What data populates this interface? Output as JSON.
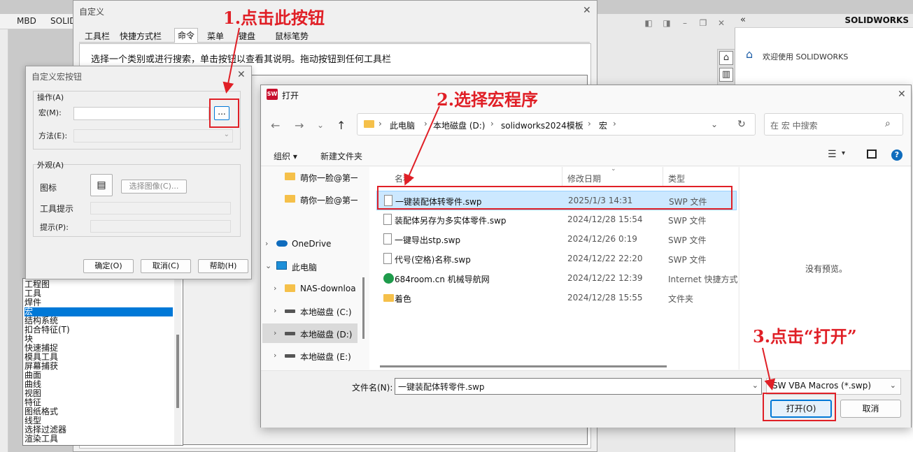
{
  "background": {
    "top_tabs": [
      "MBD",
      "SOLID"
    ],
    "task_pane": {
      "brand": "SOLIDWORKS",
      "welcome": "欢迎使用 SOLIDWORKS"
    }
  },
  "customize_dialog": {
    "title": "自定义",
    "tabs": [
      "工具栏",
      "快捷方式栏",
      "命令",
      "菜单",
      "键盘",
      "鼠标笔势"
    ],
    "active_tab": "命令",
    "description": "选择一个类别或进行搜索，单击按钮以查看其说明。拖动按钮到任何工具栏",
    "categories": [
      "工程图",
      "工具",
      "焊件",
      "宏",
      "结构系统",
      "扣合特征(T)",
      "块",
      "快速捕捉",
      "模具工具",
      "屏幕捕获",
      "曲面",
      "曲线",
      "视图",
      "特征",
      "图纸格式",
      "线型",
      "选择过滤器",
      "渲染工具"
    ],
    "selected_category": "宏"
  },
  "macro_button_dialog": {
    "title": "自定义宏按钮",
    "action_group": "操作(A)",
    "macro_label": "宏(M):",
    "macro_value": "",
    "browse_button": "...",
    "method_label": "方法(E):",
    "appearance_group": "外观(A)",
    "icon_label": "图标",
    "choose_image": "选择图像(C)...",
    "tooltip_label": "工具提示",
    "prompt_label": "提示(P):",
    "ok": "确定(O)",
    "cancel": "取消(C)",
    "help": "帮助(H)"
  },
  "open_dialog": {
    "title": "打开",
    "breadcrumb": [
      "此电脑",
      "本地磁盘 (D:)",
      "solidworks2024模板",
      "宏"
    ],
    "search_placeholder": "在 宏 中搜索",
    "toolbar": {
      "organize": "组织 ▾",
      "new_folder": "新建文件夹"
    },
    "nav_items": [
      {
        "label": "萌你一脸@第一",
        "type": "folder",
        "indent": 1,
        "chevron": ""
      },
      {
        "label": "萌你一脸@第一",
        "type": "folder",
        "indent": 1,
        "chevron": ""
      },
      {
        "label": "OneDrive",
        "type": "cloud",
        "indent": 0,
        "chevron": "›"
      },
      {
        "label": "此电脑",
        "type": "pc",
        "indent": 0,
        "chevron": "⌄"
      },
      {
        "label": "NAS-downloa",
        "type": "folder",
        "indent": 1,
        "chevron": "›"
      },
      {
        "label": "本地磁盘 (C:)",
        "type": "drive",
        "indent": 1,
        "chevron": "›"
      },
      {
        "label": "本地磁盘 (D:)",
        "type": "drive",
        "indent": 1,
        "chevron": "›"
      },
      {
        "label": "本地磁盘 (E:)",
        "type": "drive",
        "indent": 1,
        "chevron": "›"
      }
    ],
    "selected_nav": "本地磁盘 (D:)",
    "columns": {
      "name": "名称",
      "date": "修改日期",
      "type": "类型"
    },
    "files": [
      {
        "name": "一键装配体转零件.swp",
        "date": "2025/1/3 14:31",
        "type": "SWP 文件",
        "icon": "doc"
      },
      {
        "name": "装配体另存为多实体零件.swp",
        "date": "2024/12/28 15:54",
        "type": "SWP 文件",
        "icon": "doc"
      },
      {
        "name": "一键导出stp.swp",
        "date": "2024/12/26 0:19",
        "type": "SWP 文件",
        "icon": "doc"
      },
      {
        "name": "代号(空格)名称.swp",
        "date": "2024/12/22 22:20",
        "type": "SWP 文件",
        "icon": "doc"
      },
      {
        "name": "684room.cn 机械导航网",
        "date": "2024/12/22 12:39",
        "type": "Internet 快捷方式",
        "icon": "web"
      },
      {
        "name": "着色",
        "date": "2024/12/28 15:55",
        "type": "文件夹",
        "icon": "folder"
      }
    ],
    "selected_file": "一键装配体转零件.swp",
    "preview_text": "没有预览。",
    "filename_label": "文件名(N):",
    "filename_value": "一键装配体转零件.swp",
    "filetype_value": "SW VBA Macros (*.swp)",
    "open_button": "打开(O)",
    "cancel_button": "取消"
  },
  "annotations": {
    "step1": "1.点击此按钮",
    "step2": "2.选择宏程序",
    "step3": "3.点击“打开”",
    "color": "#e01f26"
  }
}
